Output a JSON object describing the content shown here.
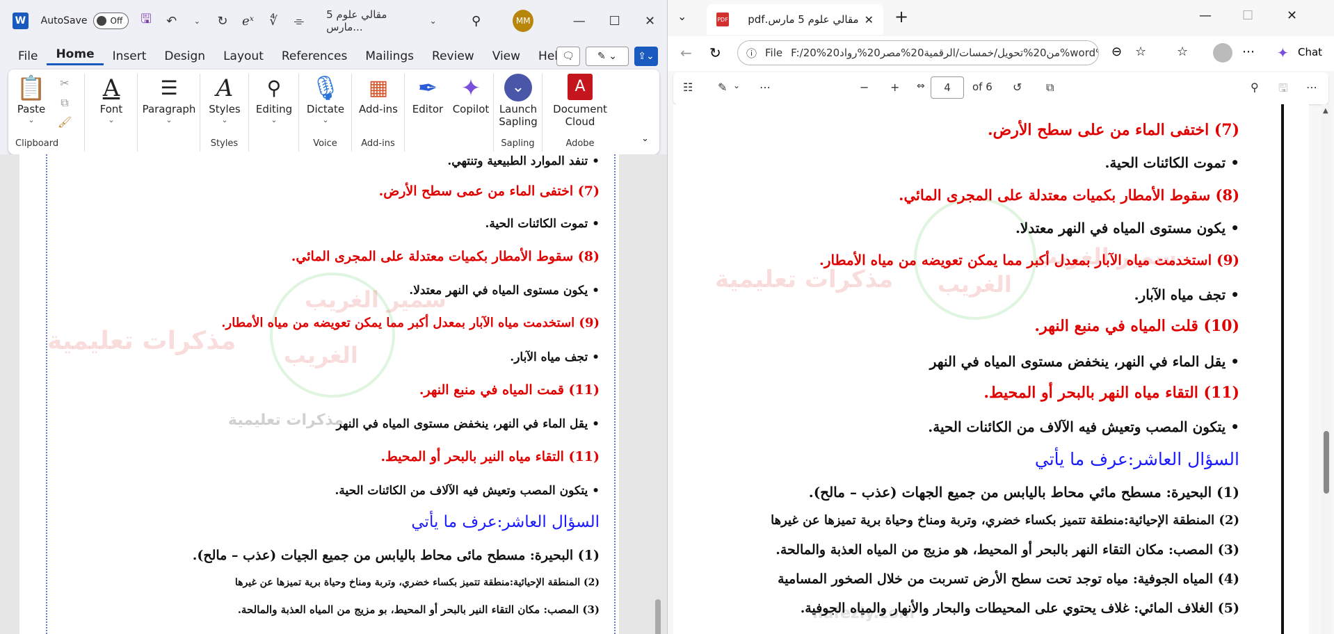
{
  "word": {
    "autosave_label": "AutoSave",
    "toggle_label": "Off",
    "doc_title": "مقالي علوم 5 مارس...",
    "avatar": "MM",
    "menu": [
      "File",
      "Home",
      "Insert",
      "Design",
      "Layout",
      "References",
      "Mailings",
      "Review",
      "View",
      "Help"
    ],
    "ribbon": {
      "paste": "Paste",
      "font": "Font",
      "paragraph": "Paragraph",
      "styles": "Styles",
      "editing": "Editing",
      "dictate": "Dictate",
      "addins": "Add-ins",
      "editor": "Editor",
      "copilot": "Copilot",
      "launch1": "Launch",
      "launch2": "Sapling",
      "doc1": "Document",
      "doc2": "Cloud",
      "g_clipboard": "Clipboard",
      "g_styles": "Styles",
      "g_voice": "Voice",
      "g_addins": "Add-ins",
      "g_sapling": "Sapling",
      "g_adobe": "Adobe"
    },
    "lines": [
      "• تنفد الموارد الطبيعية وتنتهي.",
      "(7) اختفى الماء من عمى سطح الأرض.",
      "• تموت الكائنات الحية.",
      "(8)  سقوط الأمطار بكميات معتدلة على المجرى المائي.",
      "• يكون    مستوى المياه في النهر       معتدلا.",
      "(9) استخدمت مياه الآبار بمعدل أكبر مما يمكن تعويضه من مياه الأمطار.",
      "• تجف مياه الآبار.",
      "(11) قمت المياه في منبع النهر.",
      "• يقل الماء في النهر، ينخفض مستوى المياه في النهر",
      "(11) التقاء مياه النير بالبحر أو المحيط.",
      "• يتكون المصب وتعيش فيه الآلاف من الكائنات الحية.",
      "السؤال العاشر:عرف ما يأتي",
      "(1)  البحيرة:    مسطح مائى محاط باليابس من جميع الجيات (عذب         – مالح).",
      "(2) المنطقة الإحيائية:منطقة تتميز بكساء خضري، وتربة ومناخ وحياة برية تميزها عن غيرها",
      "(3)  المصب:    مكان التقاء النير بالبحر أو المحيط، بو مزيج من المياه العذبة والمالحة."
    ],
    "watermark1": "مذكرات تعليمية",
    "watermark2": "سمير الغريب",
    "watermark3": "الغريب"
  },
  "edge": {
    "tab_title": "مقالي علوم 5 مارس.pdf",
    "url_label": "File",
    "url": "F:/20%من20%تحويل/خمسات/الرقمية20%مصر20%رواد20%word%2...",
    "chat": "Chat",
    "page_num": "4",
    "page_of": "of 6",
    "lines": [
      "(7) اختفى الماء من على سطح الأرض.",
      "• تموت الكائنات الحية.",
      "(8)  سقوط الأمطار بكميات معتدلة على المجرى المائي.",
      "• يكون مستوى المياه في النهر معتدلا.",
      "(9)  استخدمت مياه الآبار بمعدل أكبر مما يمكن تعويضه من مياه الأمطار.",
      "• تجف مياه الآبار.",
      "(10) قلت المياه في منبع النهر.",
      "• يقل الماء في النهر، ينخفض مستوى المياه في النهر",
      "(11) التقاء مياه النهر بالبحر أو المحيط.",
      "• يتكون المصب وتعيش فيه الآلاف من الكائنات الحية.",
      "السؤال العاشر:عرف ما يأتي",
      "(1)  البحيرة: مسطح مائي محاط باليابس من جميع الجهات (عذب – مالح).",
      "(2) المنطقة الإحيائية:منطقة تتميز بكساء خضري، وتربة ومناخ وحياة برية تميزها عن غيرها",
      "(3)  المصب: مكان التقاء النهر بالبحر أو المحيط، هو مزيج من المياه العذبة والمالحة.",
      "(4) المياه الجوفية: مياه توجد تحت سطح الأرض تسربت من خلال الصخور المسامية",
      "(5) الغلاف المائي: غلاف يحتوي على المحيطات والبحار والأنهار والمياه الجوفية."
    ],
    "watermark1": "مذكرات تعليمية",
    "watermark2": "سمير الغريب",
    "watermark3": "الغريب",
    "wm_site": "nafezly.com"
  }
}
